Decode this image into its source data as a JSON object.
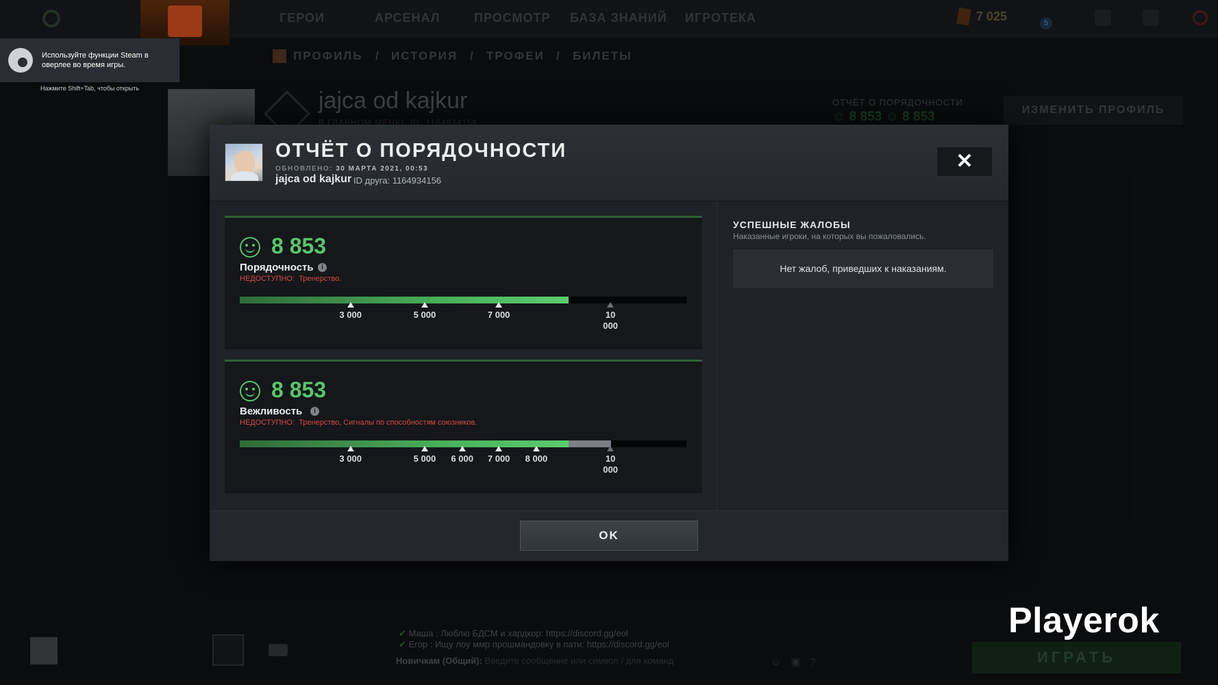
{
  "background": {
    "top_nav": [
      "ГЕРОИ",
      "АРСЕНАЛ",
      "ПРОСМОТР",
      "БАЗА ЗНАНИЙ",
      "ИГРОТЕКА"
    ],
    "shards": "7 025",
    "notification_count": "5",
    "sub_nav": [
      "ПРОФИЛЬ",
      "/",
      "ИСТОРИЯ",
      "/",
      "ТРОФЕИ",
      "/",
      "БИЛЕТЫ"
    ],
    "profile_name": "jajca od kajkur",
    "profile_sub": "В ГЛАВНОМ МЕНЮ",
    "profile_id": "ID: 1164934156",
    "conduct_title": "ОТЧЁТ О ПОРЯДОЧНОСТИ",
    "conduct_values": "☺ 8 853   ☺ 8 853",
    "edit_profile": "ИЗМЕНИТЬ ПРОФИЛЬ",
    "chat_lines": [
      {
        "name": "Маша",
        "text": "Люблю БДСМ и хардкор: https://discord.gg/eol"
      },
      {
        "name": "Егор",
        "text": "Ищу лоу ммр прошмандовку в пати: https://discord.gg/eol"
      }
    ],
    "chat_channel": "Новичкам (Общий):",
    "chat_placeholder": "Введите сообщение или символ / для команд",
    "play_button": "ИГРАТЬ"
  },
  "steam_overlay": {
    "message": "Используйте функции Steam в оверлее во время игры.",
    "hint": "Нажмите Shift+Tab, чтобы открыть"
  },
  "modal": {
    "title": "ОТЧЁТ О ПОРЯДОЧНОСТИ",
    "updated_label": "ОБНОВЛЕНО:",
    "updated_value": "30 МАРТА 2021, 00:53",
    "player_name": "jajca od kajkur",
    "friend_id": "ID друга: 1164934156",
    "close_label": "✕",
    "scores": [
      {
        "value": "8 853",
        "label": "Порядочность",
        "unavailable_prefix": "НЕДОСТУПНО:",
        "unavailable_text": "Тренерство.",
        "fill_percent": 73.6,
        "gray_percent": 0,
        "ticks": [
          {
            "label": "3 000",
            "pos": 24.8,
            "dim": false
          },
          {
            "label": "5 000",
            "pos": 41.4,
            "dim": false
          },
          {
            "label": "7 000",
            "pos": 58.0,
            "dim": false
          },
          {
            "label": "10\n000",
            "pos": 83.0,
            "dim": true
          }
        ]
      },
      {
        "value": "8 853",
        "label": "Вежливость",
        "unavailable_prefix": "НЕДОСТУПНО:",
        "unavailable_text": "Тренерство, Сигналы по способностям союзников.",
        "fill_percent": 73.6,
        "gray_percent": 9.5,
        "ticks": [
          {
            "label": "3 000",
            "pos": 24.8,
            "dim": false
          },
          {
            "label": "5 000",
            "pos": 41.4,
            "dim": false
          },
          {
            "label": "6 000",
            "pos": 49.8,
            "dim": false
          },
          {
            "label": "7 000",
            "pos": 58.0,
            "dim": false
          },
          {
            "label": "8 000",
            "pos": 66.4,
            "dim": false
          },
          {
            "label": "10\n000",
            "pos": 83.0,
            "dim": true
          }
        ]
      }
    ],
    "reports_title": "УСПЕШНЫЕ ЖАЛОБЫ",
    "reports_subtitle": "Наказанные игроки, на которых вы пожаловались.",
    "reports_empty": "Нет жалоб, приведших к наказаниям.",
    "ok_label": "OK"
  },
  "watermark": "Playerok"
}
